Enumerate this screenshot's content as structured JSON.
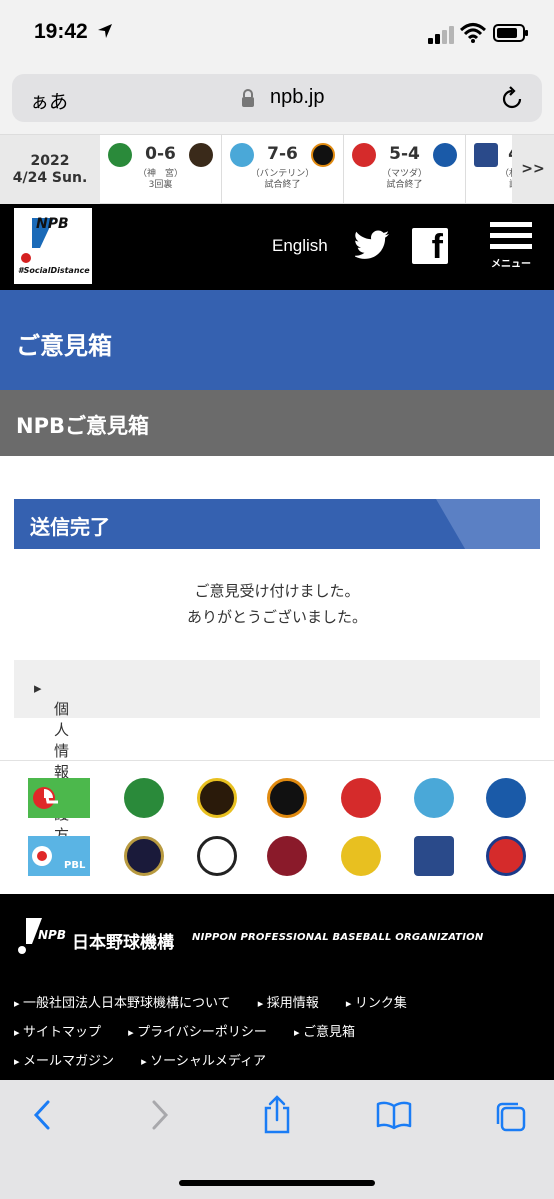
{
  "status_bar": {
    "time": "19:42"
  },
  "address_bar": {
    "aa": "ぁあ",
    "url": "npb.jp"
  },
  "scores": {
    "date_year": "2022",
    "date_day": "4/24 Sun.",
    "games": [
      {
        "score": "0-6",
        "venue": "（神　宮）",
        "status": "3回裏"
      },
      {
        "score": "7-6",
        "venue": "（バンテリン）",
        "status": "試合終了"
      },
      {
        "score": "5-4",
        "venue": "（マツダ）",
        "status": "試合終了"
      },
      {
        "score": "4",
        "venue": "（札",
        "status": "試"
      }
    ],
    "more": ">>"
  },
  "header": {
    "logo_text": "NPB",
    "logo_sub": "#SocialDistance",
    "english": "English",
    "menu_label": "メニュー"
  },
  "page": {
    "title": "ご意見箱",
    "subtitle": "NPBご意見箱",
    "sent_heading": "送信完了",
    "message_line1": "ご意見受け付けました。",
    "message_line2": "ありがとうございました。",
    "privacy_link": "個人情報保護方針"
  },
  "teams": {
    "row1": [
      "green",
      "swallows",
      "tigers",
      "giants",
      "carp",
      "dragons",
      "baystars"
    ],
    "row2": [
      "pbl",
      "buffaloes",
      "marines",
      "eagles",
      "hawks",
      "fighters",
      "lions"
    ]
  },
  "footer": {
    "mark": "NPB",
    "org_jp": "日本野球機構",
    "org_en": "NIPPON PROFESSIONAL BASEBALL ORGANIZATION",
    "links_row1": [
      "一般社団法人日本野球機構について",
      "採用情報",
      "リンク集"
    ],
    "links_row2": [
      "サイトマップ",
      "プライバシーポリシー",
      "ご意見箱"
    ],
    "links_row3": [
      "メールマガジン",
      "ソーシャルメディア"
    ]
  },
  "colors": {
    "brand_blue": "#3561b0",
    "gray_band": "#6b6b6b",
    "ios_blue": "#1a7cf5"
  }
}
